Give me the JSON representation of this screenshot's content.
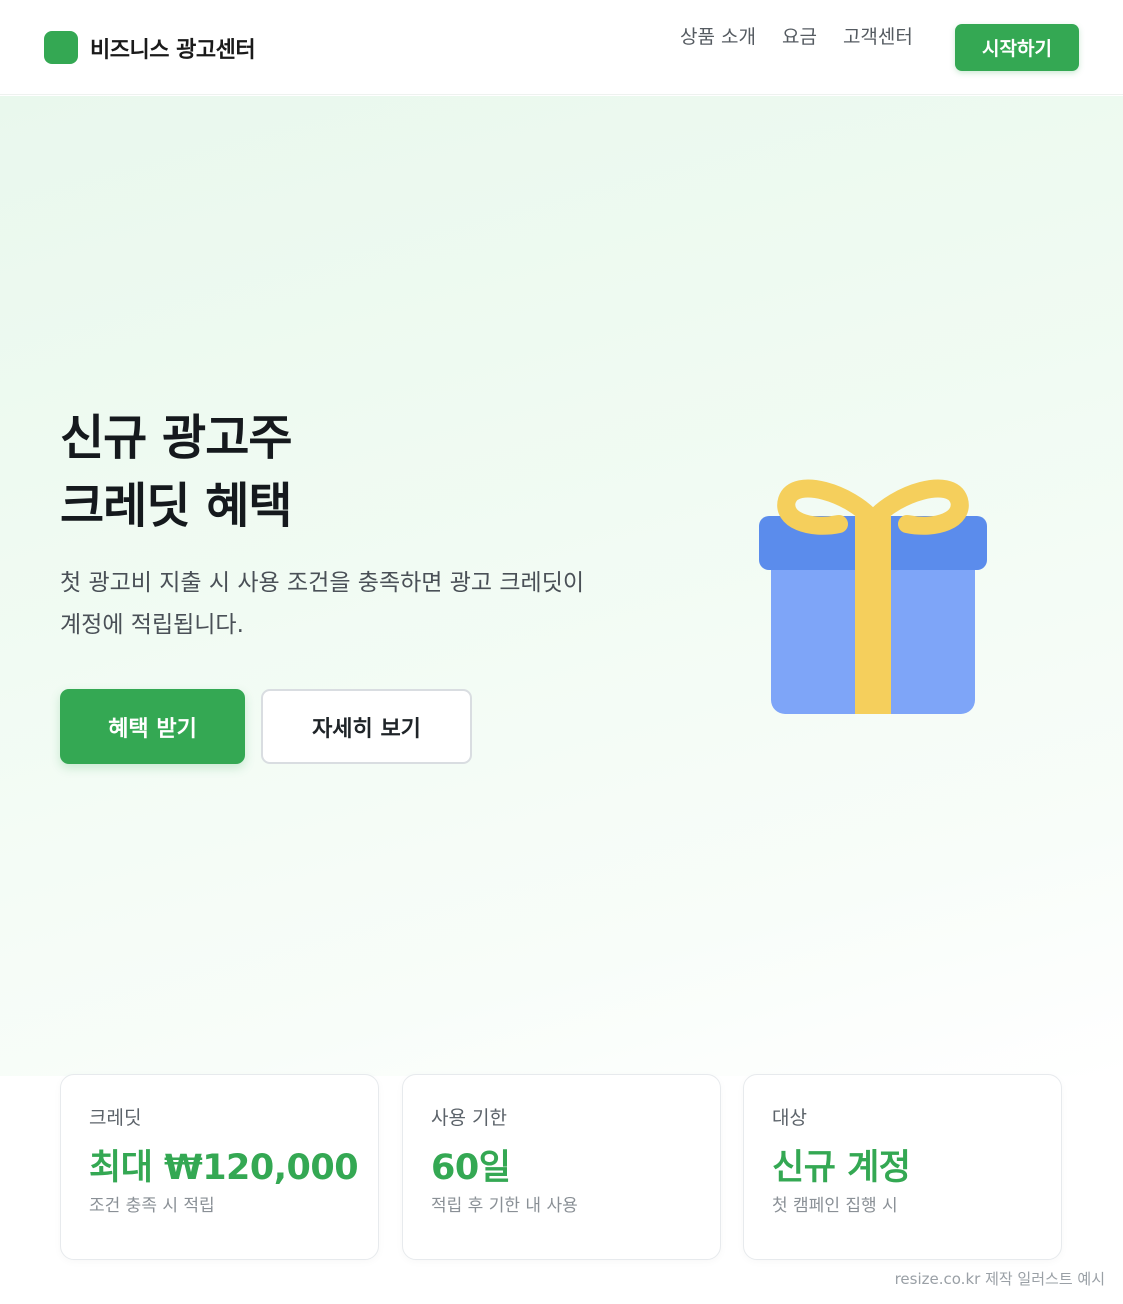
{
  "header": {
    "brand_name": "비즈니스 광고센터",
    "brand_color": "#34a853",
    "nav": [
      "상품 소개",
      "요금",
      "고객센터"
    ],
    "cta_label": "시작하기"
  },
  "hero": {
    "title_line1": "신규 광고주",
    "title_line2": "크레딧 혜택",
    "desc_line1": "첫 광고비 지출 시 사용 조건을 충족하면 광고 크레딧이",
    "desc_line2": "계정에 적립됩니다.",
    "primary_label": "혜택 받기",
    "secondary_label": "자세히 보기",
    "illustration_icon": "gift-icon"
  },
  "stats": [
    {
      "label": "크레딧",
      "value": "최대 ₩120,000",
      "note": "조건 충족 시 적립"
    },
    {
      "label": "사용 기한",
      "value": "60일",
      "note": "적립 후 기한 내 사용"
    },
    {
      "label": "대상",
      "value": "신규 계정",
      "note": "첫 캠페인 집행 시"
    }
  ],
  "footer_credit": "resize.co.kr 제작 일러스트 예시"
}
